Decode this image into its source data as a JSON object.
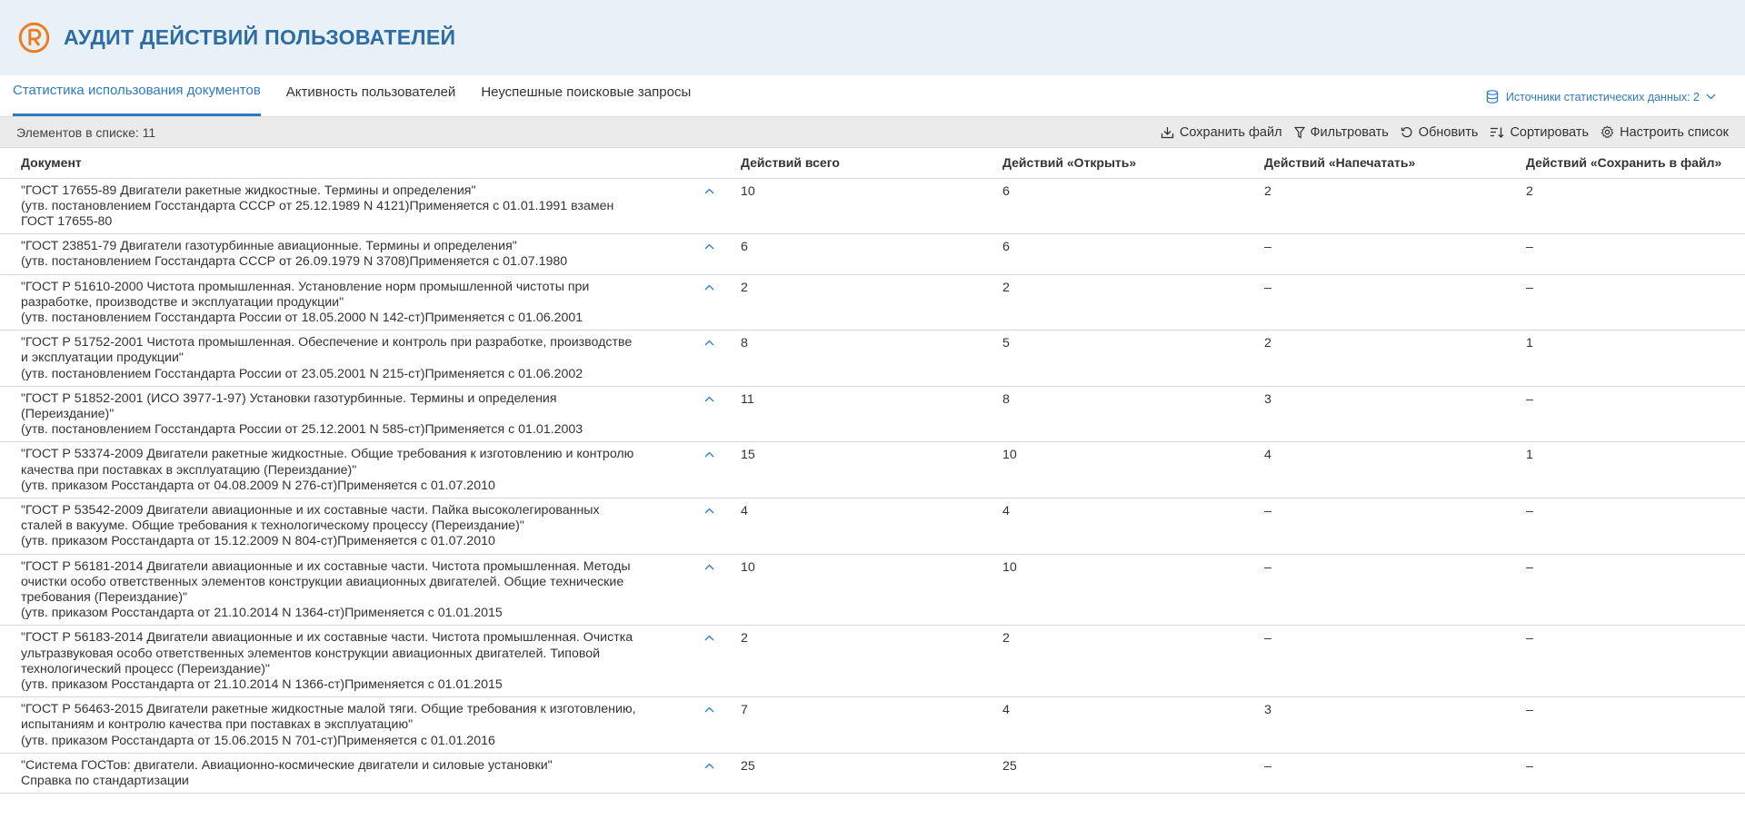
{
  "app": {
    "title": "АУДИТ ДЕЙСТВИЙ ПОЛЬЗОВАТЕЛЕЙ",
    "brand_color": "#f07c22",
    "accent": "#2e7bbf"
  },
  "tabs": [
    {
      "label": "Статистика использования документов",
      "active": true
    },
    {
      "label": "Активность пользователей",
      "active": false
    },
    {
      "label": "Неуспешные поисковые запросы",
      "active": false
    }
  ],
  "sources": {
    "label": "Источники статистических данных: 2"
  },
  "toolbar": {
    "count": "Элементов в списке: 11",
    "save": "Сохранить файл",
    "filter": "Фильтровать",
    "refresh": "Обновить",
    "sort": "Сортировать",
    "configure": "Настроить список"
  },
  "table": {
    "headers": [
      "Документ",
      "Действий всего",
      "Действий «Открыть»",
      "Действий «Напечатать»",
      "Действий «Сохранить в файл»"
    ],
    "rows": [
      {
        "lines": [
          "\"ГОСТ 17655-89 Двигатели ракетные жидкостные. Термины и определения\"",
          "(утв. постановлением Госстандарта СССР от 25.12.1989 N 4121)Применяется с 01.01.1991 взамен",
          "ГОСТ 17655-80"
        ],
        "total": "10",
        "open": "6",
        "print": "2",
        "save": "2"
      },
      {
        "lines": [
          "\"ГОСТ 23851-79 Двигатели газотурбинные авиационные. Термины и определения\"",
          "(утв. постановлением Госстандарта СССР от 26.09.1979 N 3708)Применяется с 01.07.1980"
        ],
        "total": "6",
        "open": "6",
        "print": "–",
        "save": "–"
      },
      {
        "lines": [
          "\"ГОСТ Р 51610-2000 Чистота промышленная. Установление норм промышленной чистоты при",
          "разработке, производстве и эксплуатации продукции\"",
          "(утв. постановлением Госстандарта России от 18.05.2000 N 142-ст)Применяется с 01.06.2001"
        ],
        "total": "2",
        "open": "2",
        "print": "–",
        "save": "–"
      },
      {
        "lines": [
          "\"ГОСТ Р 51752-2001 Чистота промышленная. Обеспечение и контроль при разработке, производстве",
          "и эксплуатации продукции\"",
          "(утв. постановлением Госстандарта России от 23.05.2001 N 215-ст)Применяется с 01.06.2002"
        ],
        "total": "8",
        "open": "5",
        "print": "2",
        "save": "1"
      },
      {
        "lines": [
          "\"ГОСТ Р 51852-2001 (ИСО 3977-1-97) Установки газотурбинные. Термины и определения",
          "(Переиздание)\"",
          "(утв. постановлением Госстандарта России от 25.12.2001 N 585-ст)Применяется с 01.01.2003"
        ],
        "total": "11",
        "open": "8",
        "print": "3",
        "save": "–"
      },
      {
        "lines": [
          "\"ГОСТ Р 53374-2009 Двигатели ракетные жидкостные. Общие требования к изготовлению и контролю",
          "качества при поставках в эксплуатацию (Переиздание)\"",
          "(утв. приказом Росстандарта от 04.08.2009 N 276-ст)Применяется с 01.07.2010"
        ],
        "total": "15",
        "open": "10",
        "print": "4",
        "save": "1"
      },
      {
        "lines": [
          "\"ГОСТ Р 53542-2009 Двигатели авиационные и их составные части. Пайка высоколегированных",
          "сталей в вакууме. Общие требования к технологическому процессу (Переиздание)\"",
          "(утв. приказом Росстандарта от 15.12.2009 N 804-ст)Применяется с 01.07.2010"
        ],
        "total": "4",
        "open": "4",
        "print": "–",
        "save": "–"
      },
      {
        "lines": [
          "\"ГОСТ Р 56181-2014 Двигатели авиационные и их составные части. Чистота промышленная. Методы",
          "очистки особо ответственных элементов конструкции авиационных двигателей. Общие технические",
          "требования (Переиздание)\"",
          "(утв. приказом Росстандарта от 21.10.2014 N 1364-ст)Применяется с 01.01.2015"
        ],
        "total": "10",
        "open": "10",
        "print": "–",
        "save": "–"
      },
      {
        "lines": [
          "\"ГОСТ Р 56183-2014 Двигатели авиационные и их составные части. Чистота промышленная. Очистка",
          "ультразвуковая особо ответственных элементов конструкции авиационных двигателей. Типовой",
          "технологический процесс (Переиздание)\"",
          "(утв. приказом Росстандарта от 21.10.2014 N 1366-ст)Применяется с 01.01.2015"
        ],
        "total": "2",
        "open": "2",
        "print": "–",
        "save": "–"
      },
      {
        "lines": [
          "\"ГОСТ Р 56463-2015 Двигатели ракетные жидкостные малой тяги. Общие требования к изготовлению,",
          "испытаниям и контролю качества при поставках в эксплуатацию\"",
          "(утв. приказом Росстандарта от 15.06.2015 N 701-ст)Применяется с 01.01.2016"
        ],
        "total": "7",
        "open": "4",
        "print": "3",
        "save": "–"
      },
      {
        "lines": [
          "\"Система ГОСТов: двигатели. Авиационно-космические двигатели и силовые установки\"",
          "Справка по стандартизации"
        ],
        "total": "25",
        "open": "25",
        "print": "–",
        "save": "–"
      }
    ]
  }
}
